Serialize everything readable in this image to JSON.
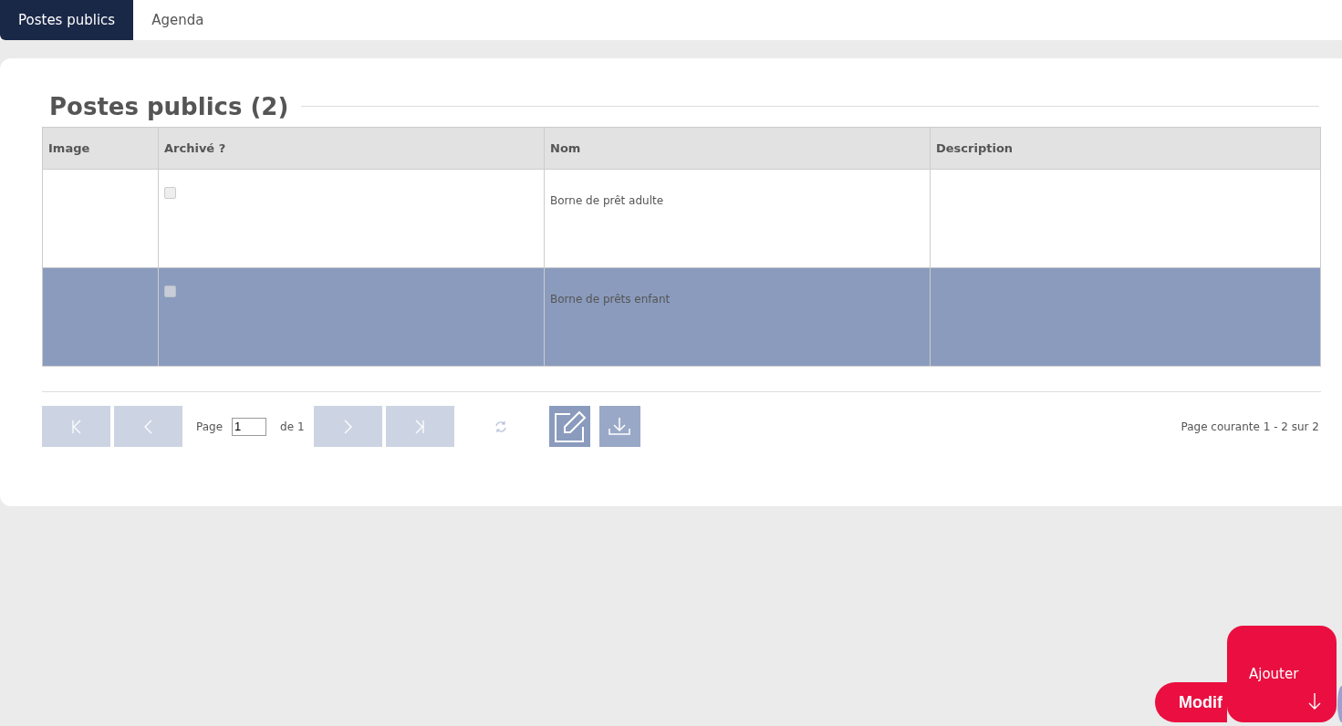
{
  "tabs": [
    {
      "label": "Postes publics",
      "selected": true
    },
    {
      "label": "Agenda",
      "selected": false
    }
  ],
  "title": "Postes publics (2)",
  "table": {
    "columns": [
      "Image",
      "Archivé ?",
      "Nom",
      "Description"
    ],
    "rows": [
      {
        "archived": false,
        "name": "Borne de prêt adulte",
        "selected": false
      },
      {
        "archived": false,
        "name": "Borne de prêts enfant",
        "selected": true
      }
    ]
  },
  "pager": {
    "page_label": "Page",
    "page": "1",
    "of_label": "de 1",
    "summary": "Page courante 1 - 2 sur 2"
  },
  "floating": {
    "modify": "Modif",
    "add": "Ajouter"
  }
}
